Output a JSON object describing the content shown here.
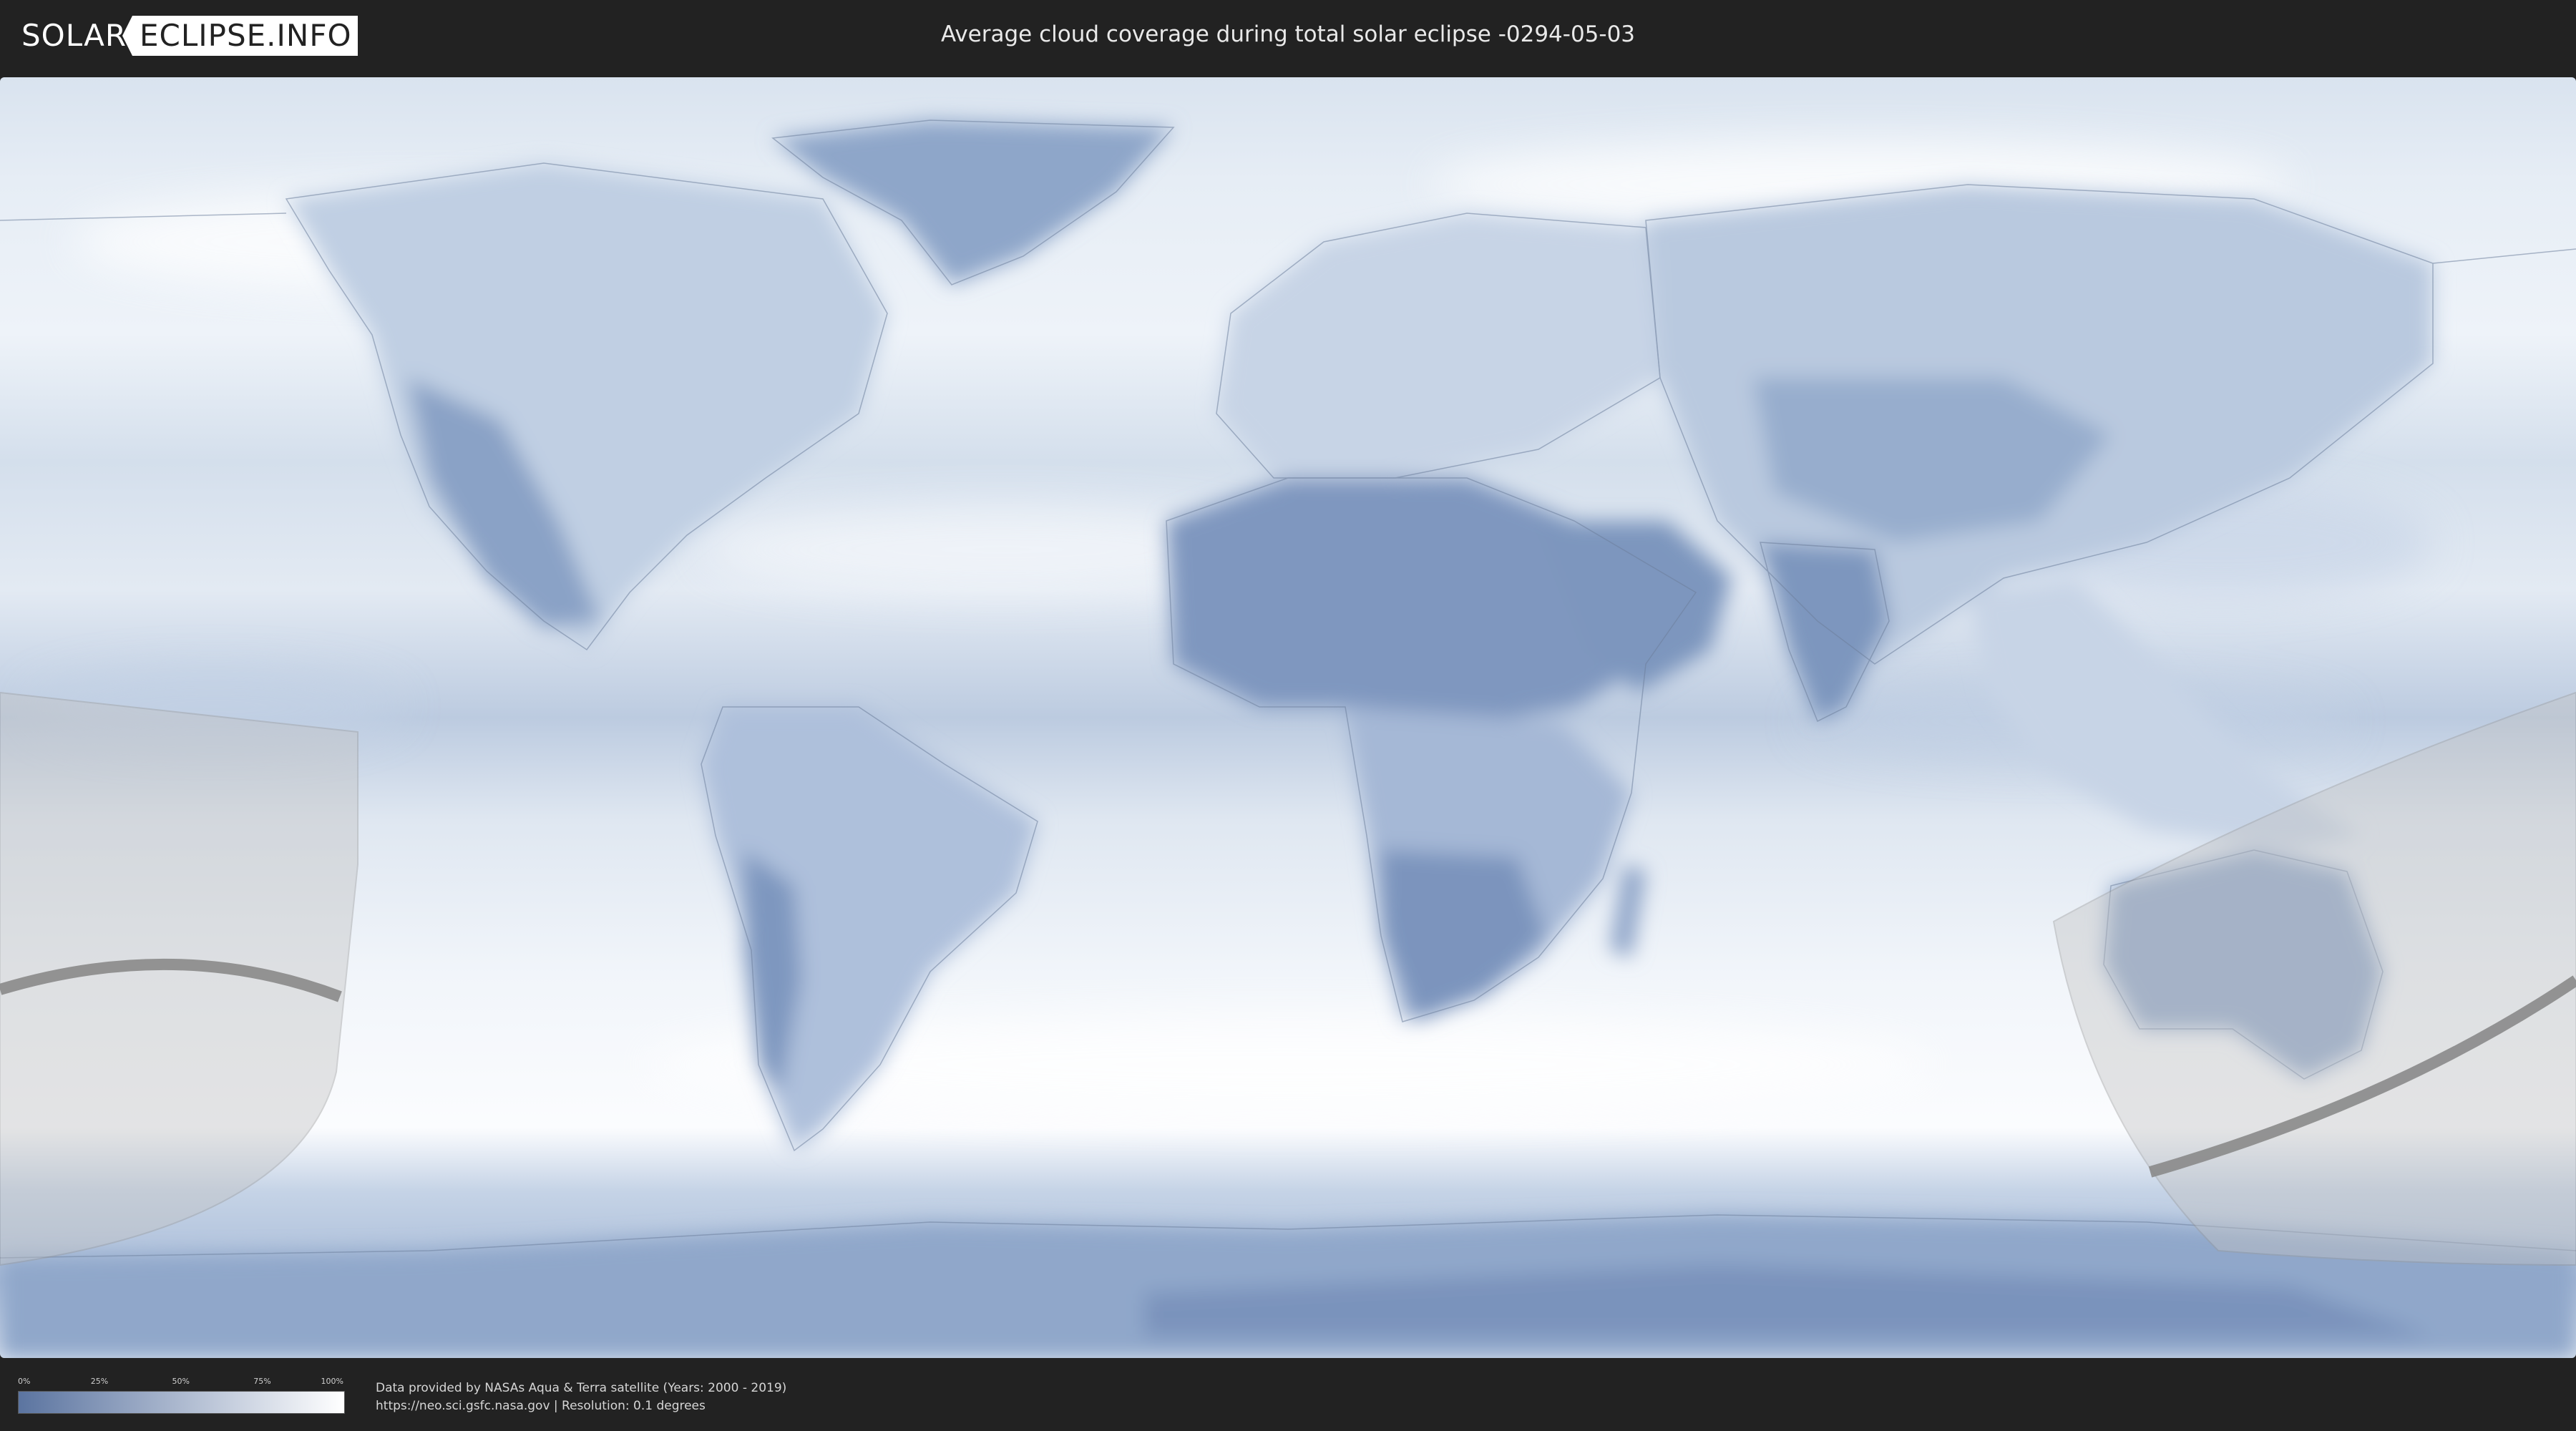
{
  "header": {
    "logo_left": "SOLAR",
    "logo_right": "ECLIPSE.INFO",
    "title": "Average cloud coverage during total solar eclipse -0294-05-03"
  },
  "legend": {
    "ticks": [
      "0%",
      "25%",
      "50%",
      "75%",
      "100%"
    ],
    "fractions": [
      0,
      0.25,
      0.5,
      0.75,
      1
    ],
    "color_low": "#5b74a0",
    "color_high": "#ffffff"
  },
  "credits": {
    "line1": "Data provided by NASAs Aqua & Terra satellite (Years: 2000 - 2019)",
    "line2": "https://neo.sci.gsfc.nasa.gov | Resolution: 0.1 degrees"
  },
  "colors": {
    "background": "#222222",
    "cloud_clear": "#6f88b4",
    "cloud_full": "#f4f7fb",
    "shadow_zone": "#c6c6c6",
    "totality_path": "#8a8a8a"
  }
}
